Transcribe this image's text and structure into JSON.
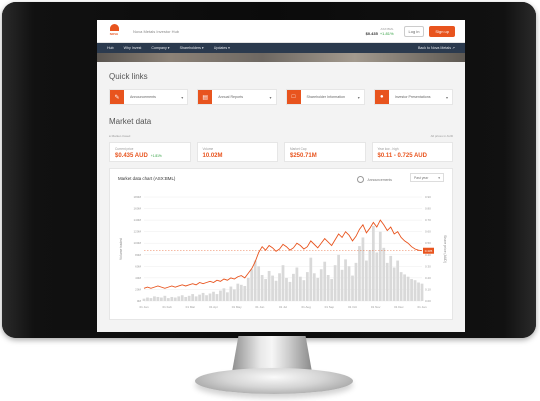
{
  "header": {
    "logo_text": "NOVA",
    "site_title": "Nova Metals Investor Hub",
    "price_label": "ASX:BML",
    "price_value": "$0.435",
    "price_change": "+1.81%",
    "login_label": "Log in",
    "signup_label": "Sign up"
  },
  "nav": {
    "items": [
      "Hub",
      "Why Invest",
      "Company ▾",
      "Shareholders ▾",
      "Updates ▾"
    ],
    "back_link": "Back to Nova Metals ↗"
  },
  "quick_links": {
    "title": "Quick links",
    "items": [
      {
        "label": "Announcements",
        "icon": "megaphone-icon"
      },
      {
        "label": "Annual Reports",
        "icon": "report-icon"
      },
      {
        "label": "Shareholder Information",
        "icon": "document-icon"
      },
      {
        "label": "Investor Presentations",
        "icon": "people-icon"
      }
    ]
  },
  "market": {
    "title": "Market data",
    "meta_left": "● Market closed",
    "meta_right": "All prices in AUD",
    "stats": [
      {
        "label": "Current price",
        "value": "$0.435 AUD",
        "change": "+1.81%"
      },
      {
        "label": "Volume",
        "value": "10.02M",
        "change": ""
      },
      {
        "label": "Market Cap",
        "value": "$250.71M",
        "change": ""
      },
      {
        "label": "Year low - high",
        "value": "$0.11 - 0.725 AUD",
        "change": ""
      }
    ]
  },
  "chart": {
    "title": "Market data chart (ASX:BML)",
    "announcements_label": "Announcements",
    "range_select": "Past year",
    "ylabel_left": "Volume traded",
    "ylabel_right": "Share price (AUD)",
    "accent": "#e8541e"
  },
  "chart_data": {
    "type": "line",
    "title": "Market data chart (ASX:BML)",
    "xlabel": "",
    "ylabel": "Share price (AUD)",
    "x_ticks": [
      "01 Jan",
      "01 Feb",
      "01 Mar",
      "01 Apr",
      "01 May",
      "01 Jun",
      "01 Jul",
      "01 Aug",
      "01 Sep",
      "01 Oct",
      "01 Nov",
      "01 Dec",
      "01 Jan"
    ],
    "y_ticks_left": [
      "0M",
      "20M",
      "40M",
      "60M",
      "80M",
      "100M",
      "120M",
      "140M",
      "160M",
      "180M"
    ],
    "y_ticks_right": [
      "0.00",
      "0.10",
      "0.20",
      "0.30",
      "0.40",
      "0.50",
      "0.60",
      "0.70",
      "0.80",
      "0.90"
    ],
    "ylim_left": [
      0,
      180
    ],
    "ylim_right": [
      0,
      0.9
    ],
    "last_price_label": "0.435",
    "series": [
      {
        "name": "Share price",
        "values": [
          0.11,
          0.12,
          0.11,
          0.12,
          0.13,
          0.12,
          0.11,
          0.12,
          0.13,
          0.12,
          0.13,
          0.14,
          0.13,
          0.14,
          0.15,
          0.14,
          0.16,
          0.15,
          0.16,
          0.17,
          0.16,
          0.18,
          0.17,
          0.19,
          0.18,
          0.2,
          0.19,
          0.21,
          0.22,
          0.2,
          0.24,
          0.28,
          0.34,
          0.42,
          0.47,
          0.44,
          0.48,
          0.46,
          0.43,
          0.45,
          0.49,
          0.47,
          0.44,
          0.46,
          0.5,
          0.48,
          0.45,
          0.47,
          0.52,
          0.49,
          0.46,
          0.5,
          0.54,
          0.51,
          0.48,
          0.53,
          0.58,
          0.55,
          0.6,
          0.57,
          0.52,
          0.56,
          0.62,
          0.66,
          0.59,
          0.63,
          0.68,
          0.64,
          0.7,
          0.66,
          0.61,
          0.64,
          0.58,
          0.6,
          0.55,
          0.52,
          0.5,
          0.47,
          0.45,
          0.44,
          0.435
        ]
      },
      {
        "name": "Volume",
        "values": [
          4,
          6,
          5,
          8,
          7,
          6,
          9,
          5,
          7,
          6,
          8,
          10,
          7,
          9,
          12,
          8,
          11,
          14,
          10,
          13,
          16,
          12,
          18,
          22,
          15,
          25,
          20,
          30,
          28,
          26,
          40,
          55,
          70,
          60,
          45,
          38,
          52,
          44,
          35,
          48,
          62,
          40,
          33,
          47,
          58,
          42,
          36,
          50,
          75,
          48,
          40,
          55,
          68,
          45,
          38,
          62,
          80,
          54,
          72,
          60,
          44,
          66,
          95,
          110,
          70,
          88,
          130,
          84,
          120,
          92,
          66,
          78,
          58,
          70,
          50,
          46,
          42,
          38,
          36,
          32,
          30
        ]
      }
    ]
  }
}
